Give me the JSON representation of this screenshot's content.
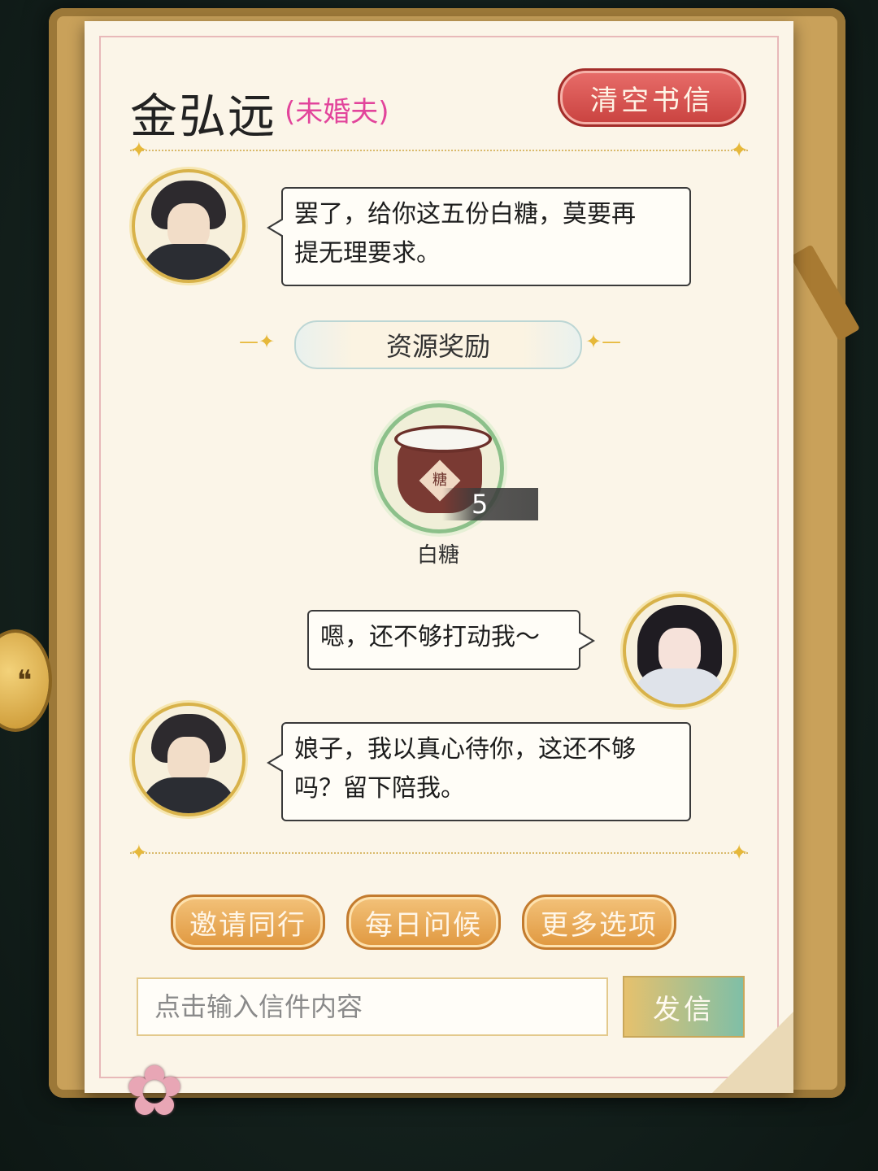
{
  "header": {
    "name": "金弘远",
    "relation": "(未婚夫)",
    "clear_button": "清空书信"
  },
  "messages": [
    {
      "speaker": "npc",
      "text_line1": "罢了，给你这五份白糖，莫要再",
      "text_line2": "提无理要求。"
    },
    {
      "speaker": "player",
      "text": "嗯，还不够打动我～"
    },
    {
      "speaker": "npc",
      "text_line1": "娘子，我以真心待你，这还不够",
      "text_line2": "吗？留下陪我。"
    }
  ],
  "reward": {
    "banner": "资源奖励",
    "item_name": "白糖",
    "item_quantity": "5",
    "item_icon_label": "糖"
  },
  "quick_actions": [
    "邀请同行",
    "每日问候",
    "更多选项"
  ],
  "composer": {
    "placeholder": "点击输入信件内容",
    "send_label": "发信"
  }
}
